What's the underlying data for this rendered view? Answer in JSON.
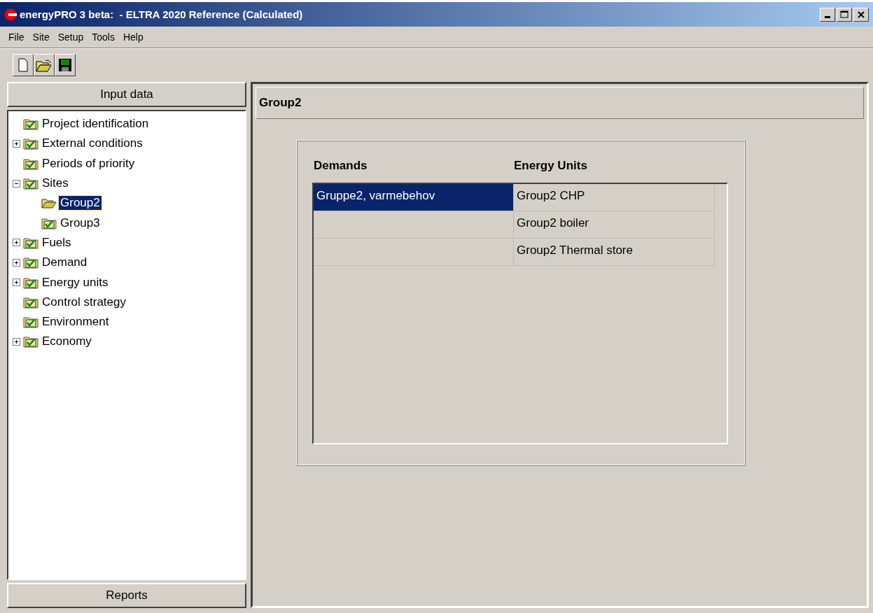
{
  "window": {
    "title": "energyPRO 3 beta:  - ELTRA 2020 Reference (Calculated)"
  },
  "menu": [
    "File",
    "Site",
    "Setup",
    "Tools",
    "Help"
  ],
  "left_panel": {
    "header": "Input data",
    "footer": "Reports"
  },
  "tree": [
    {
      "label": "Project identification",
      "expandable": false,
      "expanded": false,
      "selected": false
    },
    {
      "label": "External conditions",
      "expandable": true,
      "expanded": false,
      "selected": false
    },
    {
      "label": "Periods of priority",
      "expandable": false,
      "expanded": false,
      "selected": false
    },
    {
      "label": "Sites",
      "expandable": true,
      "expanded": true,
      "selected": false,
      "children": [
        {
          "label": "Group2",
          "expandable": false,
          "expanded": false,
          "selected": true
        },
        {
          "label": "Group3",
          "expandable": false,
          "expanded": false,
          "selected": false
        }
      ]
    },
    {
      "label": "Fuels",
      "expandable": true,
      "expanded": false,
      "selected": false
    },
    {
      "label": "Demand",
      "expandable": true,
      "expanded": false,
      "selected": false
    },
    {
      "label": "Energy units",
      "expandable": true,
      "expanded": false,
      "selected": false
    },
    {
      "label": "Control strategy",
      "expandable": false,
      "expanded": false,
      "selected": false
    },
    {
      "label": "Environment",
      "expandable": false,
      "expanded": false,
      "selected": false
    },
    {
      "label": "Economy",
      "expandable": true,
      "expanded": false,
      "selected": false
    }
  ],
  "content": {
    "title": "Group2",
    "demands_heading": "Demands",
    "energy_units_heading": "Energy Units",
    "demands": [
      {
        "label": "Gruppe2, varmebehov",
        "selected": true
      }
    ],
    "energy_units": [
      {
        "label": "Group2 CHP",
        "selected": false
      },
      {
        "label": "Group2 boiler",
        "selected": false
      },
      {
        "label": "Group2 Thermal store",
        "selected": false
      }
    ]
  }
}
